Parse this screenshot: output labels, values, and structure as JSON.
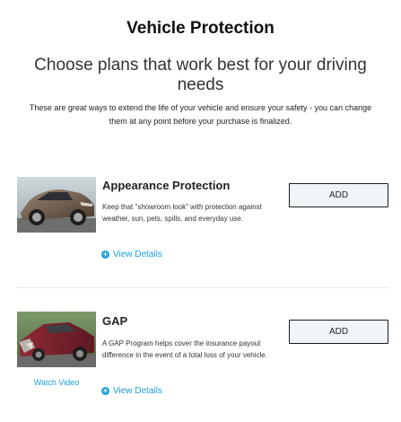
{
  "header": {
    "title": "Vehicle Protection",
    "subtitle": "Choose plans that work best for your driving needs",
    "intro": "These are great ways to extend the life of your vehicle and ensure your safety - you can change them at any point before your purchase is finalized."
  },
  "plans": [
    {
      "name": "Appearance Protection",
      "description": "Keep that \"showroom look\" with protection against weather, sun, pets, spills, and everyday use.",
      "details_label": "View Details",
      "add_label": "ADD",
      "image_icon": "car-photo-icon"
    },
    {
      "name": "GAP",
      "description": "A GAP Program helps cover the insurance payout difference in the event of a total loss of your vehicle.",
      "details_label": "View Details",
      "add_label": "ADD",
      "video_label": "Watch Video",
      "image_icon": "damaged-car-photo-icon"
    }
  ],
  "colors": {
    "link": "#1a9fd8",
    "button_bg": "#f0f5fa",
    "button_border": "#1c1c1c",
    "divider": "#e6e6e6"
  }
}
